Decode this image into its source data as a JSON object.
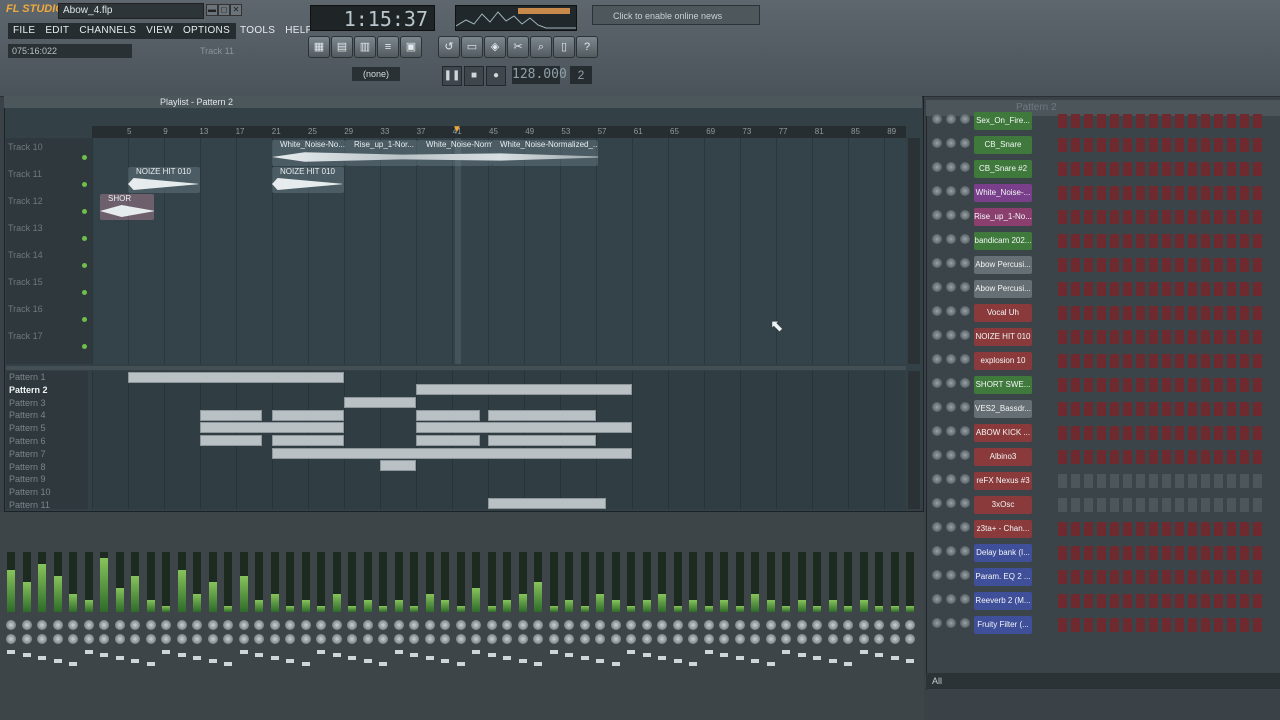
{
  "app": {
    "logo": "FL STUDIO",
    "filename": "Abow_4.flp",
    "clock": "1:15:37",
    "news": "Click to enable online news",
    "pattern_select": "(none)",
    "tempo": "128.000",
    "step": "2"
  },
  "menu": [
    "FILE",
    "EDIT",
    "CHANNELS",
    "VIEW",
    "OPTIONS",
    "TOOLS",
    "HELP"
  ],
  "status": {
    "timecode": "075:16:022",
    "hint": "Track 11"
  },
  "playlist": {
    "title": "Playlist - Pattern 2",
    "ruler": [
      "5",
      "9",
      "13",
      "17",
      "21",
      "25",
      "29",
      "33",
      "37",
      "41",
      "45",
      "49",
      "53",
      "57",
      "61",
      "65",
      "69",
      "73",
      "77",
      "81",
      "85",
      "89"
    ],
    "tracks": [
      "Track 10",
      "Track 11",
      "Track 12",
      "Track 13",
      "Track 14",
      "Track 15",
      "Track 16",
      "Track 17"
    ],
    "clips": [
      {
        "label": "White_Noise-No..."
      },
      {
        "label": "Rise_up_1-Nor..."
      },
      {
        "label": "White_Noise-Norm..."
      },
      {
        "label": "White_Noise-Normalized_..."
      },
      {
        "label": "NOIZE HIT 010"
      },
      {
        "label": "NOIZE HIT 010"
      },
      {
        "label": "SHOR"
      }
    ],
    "patterns": [
      "Pattern 1",
      "Pattern 2",
      "Pattern 3",
      "Pattern 4",
      "Pattern 5",
      "Pattern 6",
      "Pattern 7",
      "Pattern 8",
      "Pattern 9",
      "Pattern 10",
      "Pattern 11"
    ]
  },
  "rack": {
    "title": "Pattern 2",
    "filter": "All",
    "channels": [
      {
        "name": "Sex_On_Fire...",
        "color": "#3f7a3c"
      },
      {
        "name": "CB_Snare",
        "color": "#3f7a3c"
      },
      {
        "name": "CB_Snare #2",
        "color": "#3f7a3c"
      },
      {
        "name": "White_Noise-...",
        "color": "#7a3f8a"
      },
      {
        "name": "Rise_up_1-No...",
        "color": "#8a3f6f"
      },
      {
        "name": "bandicam 202...",
        "color": "#3f7a3c"
      },
      {
        "name": "Abow Percusi...",
        "color": "#666f73"
      },
      {
        "name": "Abow Percusi...",
        "color": "#666f73"
      },
      {
        "name": "Vocal Uh",
        "color": "#8a3a3a"
      },
      {
        "name": "NOIZE HIT 010",
        "color": "#8a3a3a"
      },
      {
        "name": "explosion 10",
        "color": "#8a3a3a"
      },
      {
        "name": "SHORT SWE...",
        "color": "#3f7a3c"
      },
      {
        "name": "VES2_Bassdr...",
        "color": "#666f73"
      },
      {
        "name": "ABOW KICK ...",
        "color": "#8a3a3a"
      },
      {
        "name": "Albino3",
        "color": "#8a3a3a"
      },
      {
        "name": "reFX Nexus #3",
        "color": "#8a3a3a"
      },
      {
        "name": "3xOsc",
        "color": "#8a3a3a"
      },
      {
        "name": "z3ta+ - Chan...",
        "color": "#8a3a3a"
      },
      {
        "name": "Delay bank (I...",
        "color": "#3f4f9a"
      },
      {
        "name": "Param. EQ 2 ...",
        "color": "#3f4f9a"
      },
      {
        "name": "Reeverb 2 (M...",
        "color": "#3f4f9a"
      },
      {
        "name": "Fruity Filter (...",
        "color": "#3f4f9a"
      }
    ]
  },
  "mixer": {
    "levels": [
      0.7,
      0.5,
      0.8,
      0.6,
      0.3,
      0.2,
      0.9,
      0.4,
      0.6,
      0.2,
      0.1,
      0.7,
      0.3,
      0.5,
      0.1,
      0.6,
      0.2,
      0.3,
      0.1,
      0.2,
      0.1,
      0.3,
      0.1,
      0.2,
      0.1,
      0.2,
      0.1,
      0.3,
      0.2,
      0.1,
      0.4,
      0.1,
      0.2,
      0.3,
      0.5,
      0.1,
      0.2,
      0.1,
      0.3,
      0.2,
      0.1,
      0.2,
      0.3,
      0.1,
      0.2,
      0.1,
      0.2,
      0.1,
      0.3,
      0.2,
      0.1,
      0.2,
      0.1,
      0.2,
      0.1,
      0.2,
      0.1,
      0.1,
      0.1
    ]
  }
}
